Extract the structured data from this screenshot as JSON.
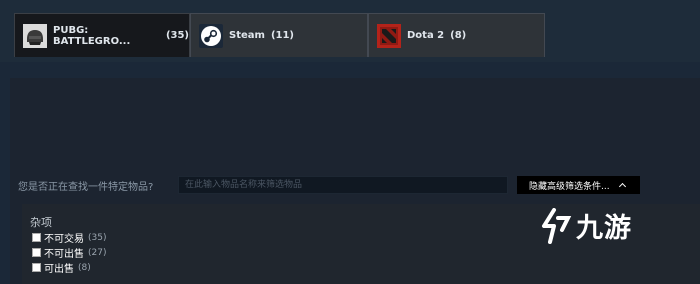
{
  "tabs": [
    {
      "label": "PUBG: BATTLEGRO...",
      "count": "(35)",
      "icon": "pubg-helmet-icon"
    },
    {
      "label": "Steam",
      "count": "(11)",
      "icon": "steam-icon"
    },
    {
      "label": "Dota 2",
      "count": "(8)",
      "icon": "dota2-icon"
    }
  ],
  "search": {
    "label": "您是否正在查找一件特定物品?",
    "placeholder": "在此输入物品名称来筛选物品"
  },
  "advanced_toggle": {
    "label": "隐藏高级筛选条件...",
    "icon": "chevron-up-icon"
  },
  "filters": {
    "title": "杂项",
    "items": [
      {
        "label": "不可交易",
        "count": "(35)"
      },
      {
        "label": "不可出售",
        "count": "(27)"
      },
      {
        "label": "可出售",
        "count": "(8)"
      }
    ]
  },
  "watermark": {
    "text": "九游"
  },
  "colors": {
    "background": "#1b2838",
    "tab_active": "#16181c",
    "tab_inactive": "#2e3338",
    "button_bg": "#000000",
    "dota_red": "#b3231a"
  }
}
